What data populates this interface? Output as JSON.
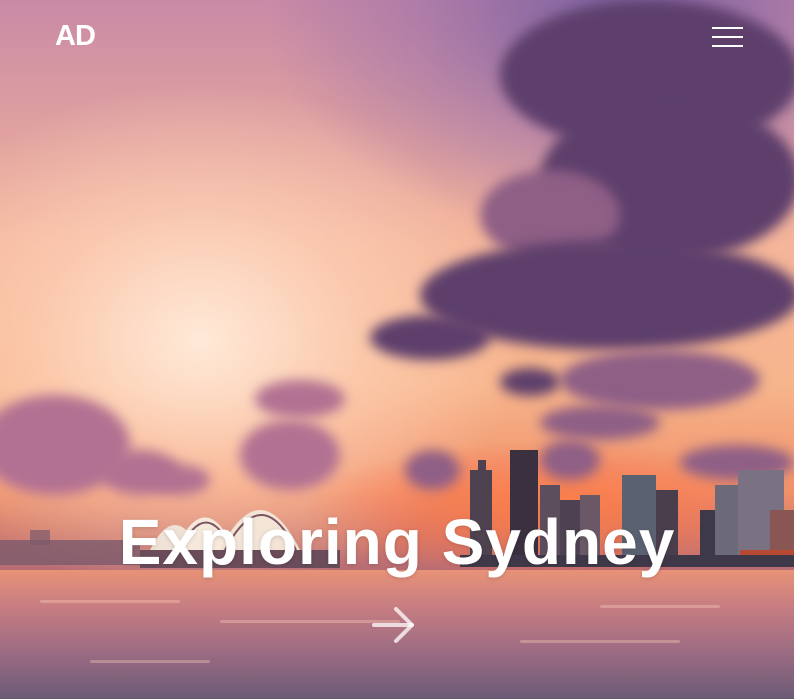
{
  "header": {
    "logo_text": "AD",
    "menu_icon": "hamburger-menu-icon"
  },
  "hero": {
    "title": "Exploring Sydney",
    "next_icon": "arrow-right-icon",
    "background_image": "sunset-sydney-harbour-skyline"
  },
  "colors": {
    "text": "#ffffff",
    "cloud": "#5e3f6c",
    "sky_glow": "#f7b58c"
  }
}
